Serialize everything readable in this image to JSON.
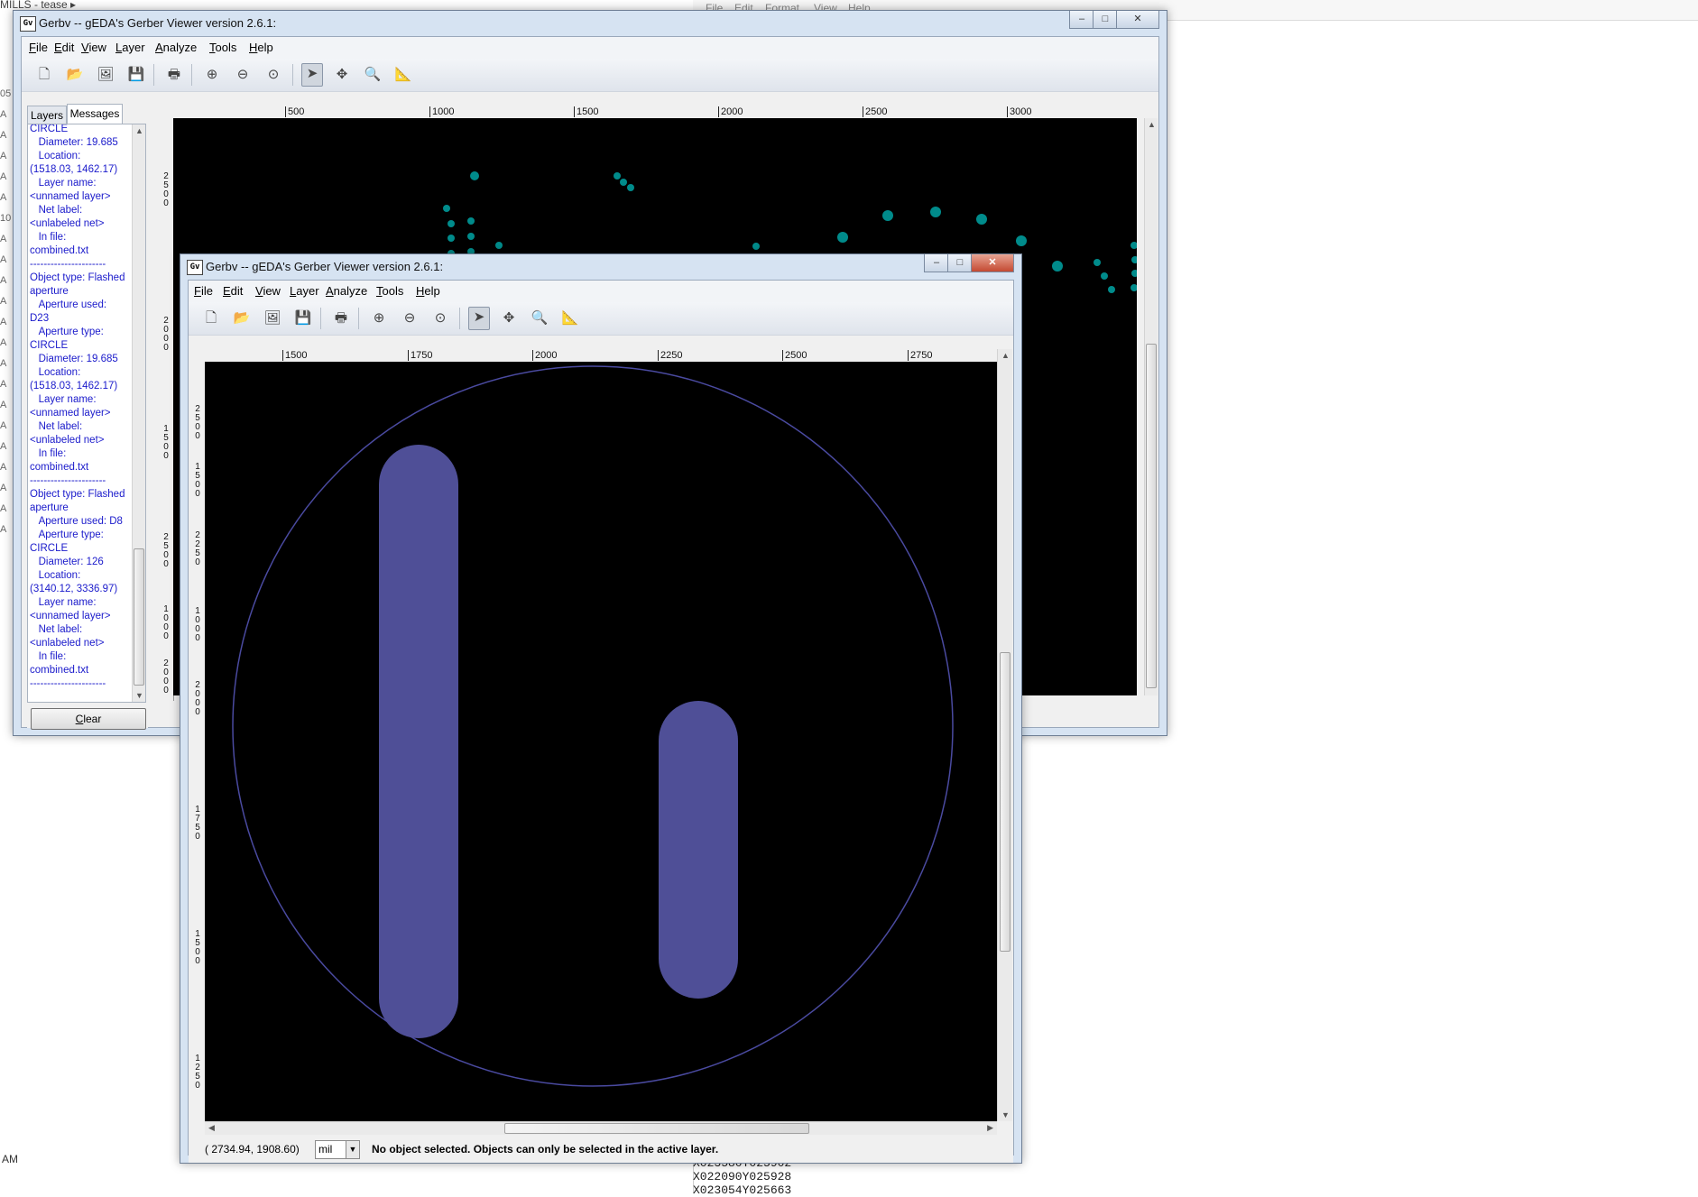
{
  "background": {
    "left_crumb": "MILLS - tease",
    "left_letters": [
      "05",
      "A",
      "A",
      "A",
      "A",
      "A",
      "10",
      "A",
      "A",
      "A",
      "A",
      "A",
      "A",
      "A",
      "A",
      "A",
      "A",
      "A",
      "A",
      "A",
      "A",
      "A"
    ],
    "taskbar_time": "AM",
    "editor_menu": [
      "File",
      "Edit",
      "Format",
      "View",
      "Help"
    ],
    "editor_lines": [
      "X023580Y025902",
      "X022090Y025928",
      "X023054Y025663"
    ]
  },
  "back_window": {
    "title": "Gerbv -- gEDA's Gerber Viewer version 2.6.1:",
    "menu": [
      "File",
      "Edit",
      "View",
      "Layer",
      "Analyze",
      "Tools",
      "Help"
    ],
    "tabs": [
      "Layers",
      "Messages"
    ],
    "messages": "CIRCLE\n   Diameter: 19.685\n   Location:\n(1518.03, 1462.17)\n   Layer name:\n<unnamed layer>\n   Net label:\n<unlabeled net>\n   In file:\ncombined.txt\n----------------------\nObject type: Flashed aperture\n   Aperture used:\nD23\n   Aperture type:\nCIRCLE\n   Diameter: 19.685\n   Location:\n(1518.03, 1462.17)\n   Layer name:\n<unnamed layer>\n   Net label:\n<unlabeled net>\n   In file:\ncombined.txt\n----------------------\nObject type: Flashed aperture\n   Aperture used: D8\n   Aperture type:\nCIRCLE\n   Diameter: 126\n   Location:\n(3140.12, 3336.97)\n   Layer name:\n<unnamed layer>\n   Net label:\n<unlabeled net>\n   In file:\ncombined.txt\n----------------------",
    "clear_label": "Clear",
    "ruler_top": [
      "500",
      "1000",
      "1500",
      "2000",
      "2500",
      "3000"
    ],
    "ruler_left": [
      "2500",
      "2000",
      "1500",
      "2500",
      "1000",
      "2000"
    ],
    "pad_color": "#008b8b"
  },
  "front_window": {
    "title": "Gerbv -- gEDA's Gerber Viewer version 2.6.1:",
    "menu": [
      "File",
      "Edit",
      "View",
      "Layer",
      "Analyze",
      "Tools",
      "Help"
    ],
    "ruler_top": [
      "1500",
      "1750",
      "2000",
      "2250",
      "2500",
      "2750"
    ],
    "ruler_left": [
      "2500",
      "1500",
      "2250",
      "1000",
      "2000",
      "1750",
      "1500",
      "1250"
    ],
    "shape_color": "#4f4f97",
    "outline_color": "#4a4aa0",
    "status": {
      "coords": "( 2734.94,  1908.60)",
      "unit": "mil",
      "message": "No object selected. Objects can only be selected in the active layer."
    }
  }
}
